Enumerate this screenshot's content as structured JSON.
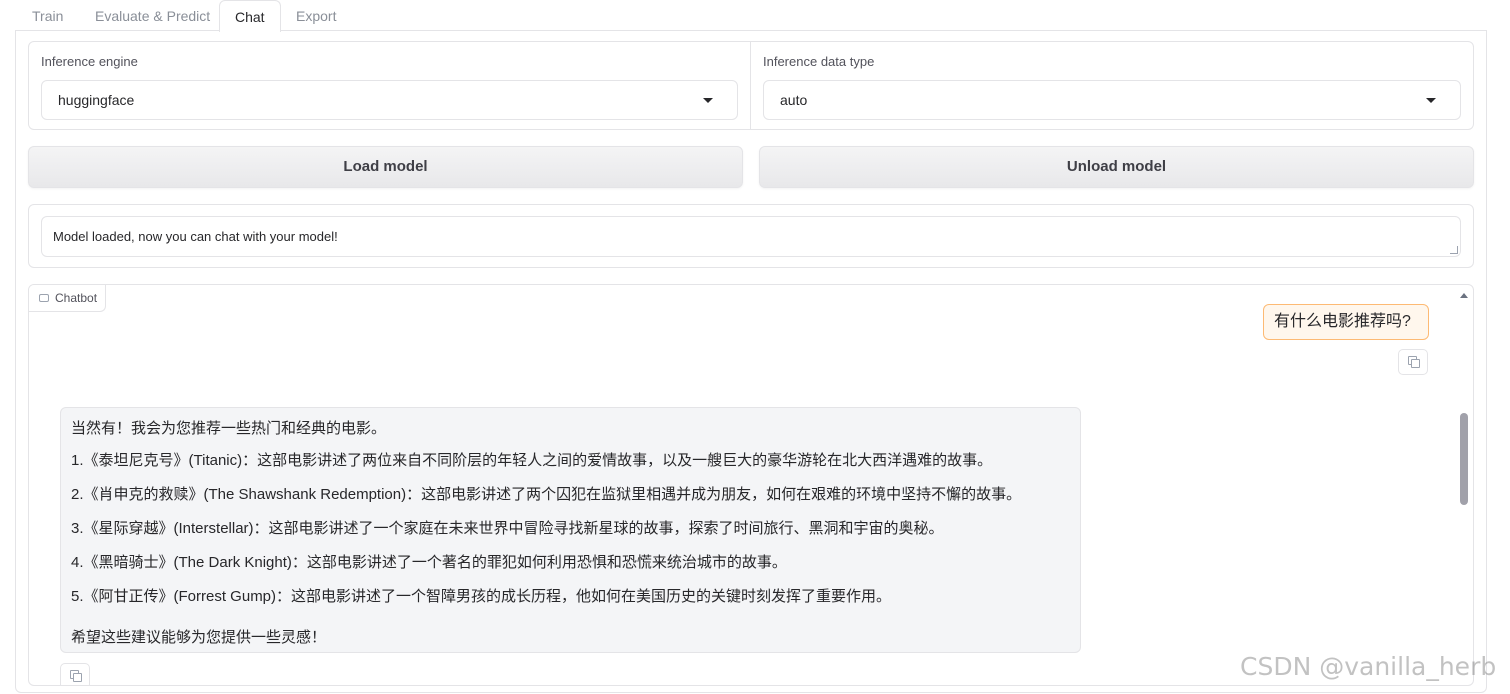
{
  "tabs": [
    {
      "label": "Train"
    },
    {
      "label": "Evaluate & Predict"
    },
    {
      "label": "Chat"
    },
    {
      "label": "Export"
    }
  ],
  "inference_engine": {
    "label": "Inference engine",
    "value": "huggingface"
  },
  "inference_dtype": {
    "label": "Inference data type",
    "value": "auto"
  },
  "buttons": {
    "load": "Load model",
    "unload": "Unload model"
  },
  "status": {
    "text": "Model loaded, now you can chat with your model!"
  },
  "chatbot": {
    "label": "Chatbot",
    "user_message": "有什么电影推荐吗?",
    "bot_lines": [
      "当然有！我会为您推荐一些热门和经典的电影。",
      "1.《泰坦尼克号》(Titanic)：这部电影讲述了两位来自不同阶层的年轻人之间的爱情故事，以及一艘巨大的豪华游轮在北大西洋遇难的故事。",
      "2.《肖申克的救赎》(The Shawshank Redemption)：这部电影讲述了两个囚犯在监狱里相遇并成为朋友，如何在艰难的环境中坚持不懈的故事。",
      "3.《星际穿越》(Interstellar)：这部电影讲述了一个家庭在未来世界中冒险寻找新星球的故事，探索了时间旅行、黑洞和宇宙的奥秘。",
      "4.《黑暗骑士》(The Dark Knight)：这部电影讲述了一个著名的罪犯如何利用恐惧和恐慌来统治城市的故事。",
      "5.《阿甘正传》(Forrest Gump)：这部电影讲述了一个智障男孩的成长历程，他如何在美国历史的关键时刻发挥了重要作用。",
      "希望这些建议能够为您提供一些灵感！"
    ]
  },
  "watermark": "CSDN @vanilla_herb"
}
